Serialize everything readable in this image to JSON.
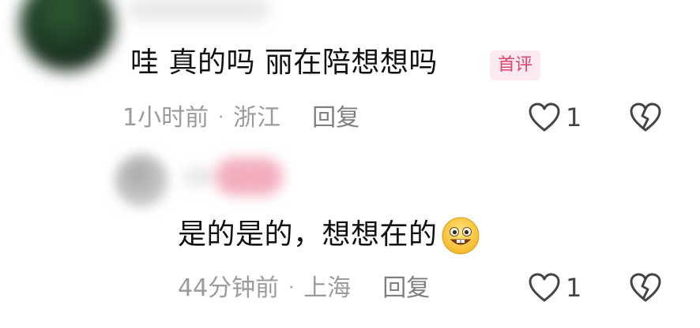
{
  "comments": [
    {
      "text": "哇 真的吗 丽在陪想想吗",
      "badge": "首评",
      "time": "1小时前",
      "location": "浙江",
      "reply_label": "回复",
      "likes": "1"
    },
    {
      "text": "是的是的，想想在的",
      "emoji": "grinning-face-emoji",
      "time": "44分钟前",
      "location": "上海",
      "reply_label": "回复",
      "likes": "1"
    }
  ],
  "separator": "·",
  "colors": {
    "meta_text": "#9b9b9b",
    "badge_text": "#e0426b",
    "badge_background": "#fdeaf0"
  },
  "icons": {
    "like": "heart-outline-icon",
    "dislike": "broken-heart-icon"
  }
}
